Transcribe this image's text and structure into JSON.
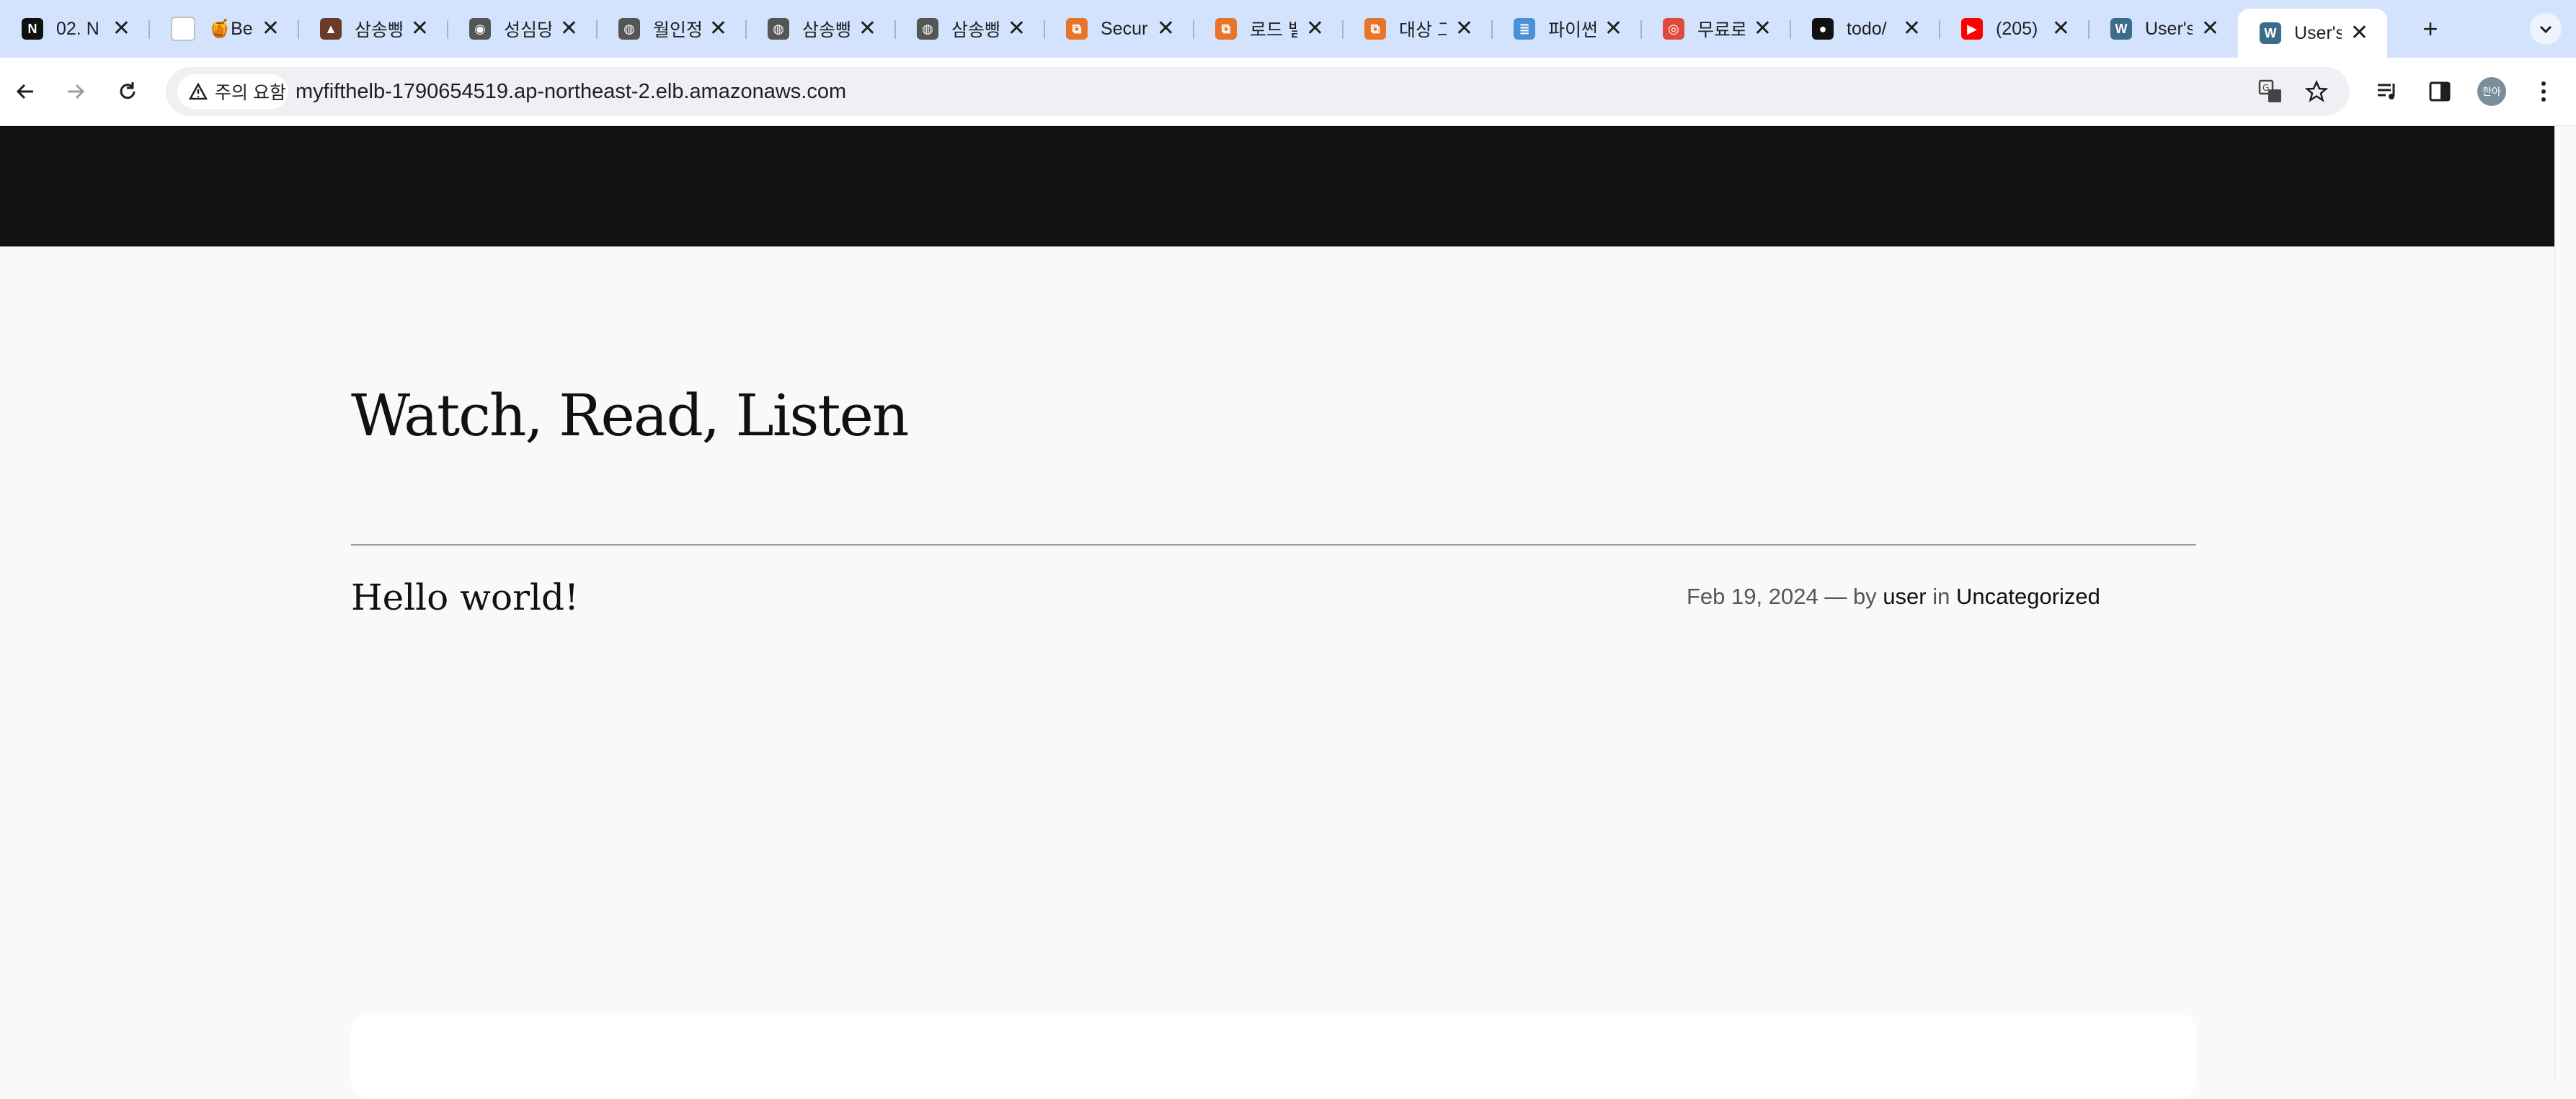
{
  "browser": {
    "tabs": [
      {
        "title": "02. N",
        "icon": "notion-icon",
        "color": "#111111",
        "glyph": "N",
        "active": false
      },
      {
        "title": "🍯Be",
        "icon": "document-icon",
        "color": "#ffffff",
        "glyph": "",
        "active": false
      },
      {
        "title": "삼송빵",
        "icon": "bakery-icon",
        "color": "#6b3a2a",
        "glyph": "▲",
        "active": false
      },
      {
        "title": "성심당",
        "icon": "eye-icon",
        "color": "#555555",
        "glyph": "◉",
        "active": false
      },
      {
        "title": "월인정",
        "icon": "globe-icon",
        "color": "#555555",
        "glyph": "◍",
        "active": false
      },
      {
        "title": "삼송빵",
        "icon": "globe-icon",
        "color": "#555555",
        "glyph": "◍",
        "active": false
      },
      {
        "title": "삼송빵",
        "icon": "globe-icon",
        "color": "#555555",
        "glyph": "◍",
        "active": false
      },
      {
        "title": "Secur",
        "icon": "aws-icon",
        "color": "#e8742a",
        "glyph": "⧉",
        "active": false
      },
      {
        "title": "로드 밸",
        "icon": "aws-icon",
        "color": "#e8742a",
        "glyph": "⧉",
        "active": false
      },
      {
        "title": "대상 그",
        "icon": "aws-icon",
        "color": "#e8742a",
        "glyph": "⧉",
        "active": false
      },
      {
        "title": "파이썬",
        "icon": "python-tutor-icon",
        "color": "#4a90d9",
        "glyph": "≣",
        "active": false
      },
      {
        "title": "무료로",
        "icon": "freecode-icon",
        "color": "#e04a3a",
        "glyph": "◎",
        "active": false
      },
      {
        "title": "todo/",
        "icon": "github-icon",
        "color": "#111111",
        "glyph": "●",
        "active": false
      },
      {
        "title": "(205)",
        "icon": "youtube-icon",
        "color": "#ff0000",
        "glyph": "▶",
        "active": false
      },
      {
        "title": "User's",
        "icon": "wordpress-icon",
        "color": "#3c6c8c",
        "glyph": "W",
        "active": false
      },
      {
        "title": "User's",
        "icon": "wordpress-icon",
        "color": "#3c6c8c",
        "glyph": "W",
        "active": true
      }
    ],
    "close_glyph": "✕",
    "new_tab_glyph": "+",
    "security_label": "주의 요함",
    "url": "myfifthelb-1790654519.ap-northeast-2.elb.amazonaws.com",
    "profile_label": "한아"
  },
  "page": {
    "site_title": "Watch, Read, Listen",
    "post": {
      "title": "Hello world!",
      "date": "Feb 19, 2024",
      "by_text": "— by",
      "author": "user",
      "in_text": "in",
      "category": "Uncategorized"
    }
  }
}
